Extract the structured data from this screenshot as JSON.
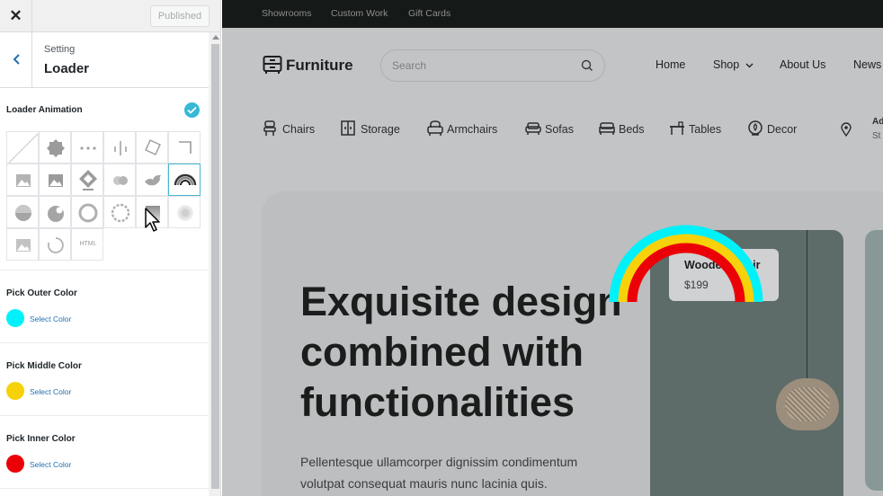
{
  "customizer": {
    "close_icon": "close-icon",
    "publish_label": "Published",
    "back_icon": "chevron-left-icon",
    "subtitle": "Setting",
    "title": "Loader",
    "loader_animation_label": "Loader Animation",
    "loader_cells": [
      "none-slash",
      "badge",
      "dots",
      "bars",
      "square-rotate",
      "corner",
      "image",
      "image-flag",
      "diamond",
      "two-circles",
      "bird",
      "rainbow",
      "circle-shade",
      "blob",
      "ring",
      "dotted-ring",
      "square-gradient",
      "dot-glow",
      "image-small",
      "spinner-arc",
      "html"
    ],
    "html_cell_label": "HTML",
    "selected_cell": "rainbow",
    "outer_color_label": "Pick Outer Color",
    "middle_color_label": "Pick Middle Color",
    "inner_color_label": "Pick Inner Color",
    "select_color_label": "Select Color",
    "outer_color": "#00f1fa",
    "middle_color": "#f7d20a",
    "inner_color": "#ec0008"
  },
  "preview": {
    "top_links": [
      "Showrooms",
      "Custom Work",
      "Gift Cards"
    ],
    "logo_text": "Furniture",
    "search_placeholder": "Search",
    "nav": [
      "Home",
      "Shop",
      "About Us",
      "News"
    ],
    "categories": [
      {
        "label": "Chairs",
        "icon": "chair-icon"
      },
      {
        "label": "Storage",
        "icon": "storage-icon"
      },
      {
        "label": "Armchairs",
        "icon": "armchair-icon"
      },
      {
        "label": "Sofas",
        "icon": "sofa-icon"
      },
      {
        "label": "Beds",
        "icon": "bed-icon"
      },
      {
        "label": "Tables",
        "icon": "table-icon"
      },
      {
        "label": "Decor",
        "icon": "decor-icon"
      }
    ],
    "location_line1": "Ad",
    "location_line2": "St",
    "hero_title": "Exquisite design combined with functionalities",
    "hero_text": "Pellentesque ullamcorper dignissim condimentum volutpat consequat mauris nunc lacinia quis.",
    "product_name": "Wooden Chair",
    "product_price": "$199"
  }
}
